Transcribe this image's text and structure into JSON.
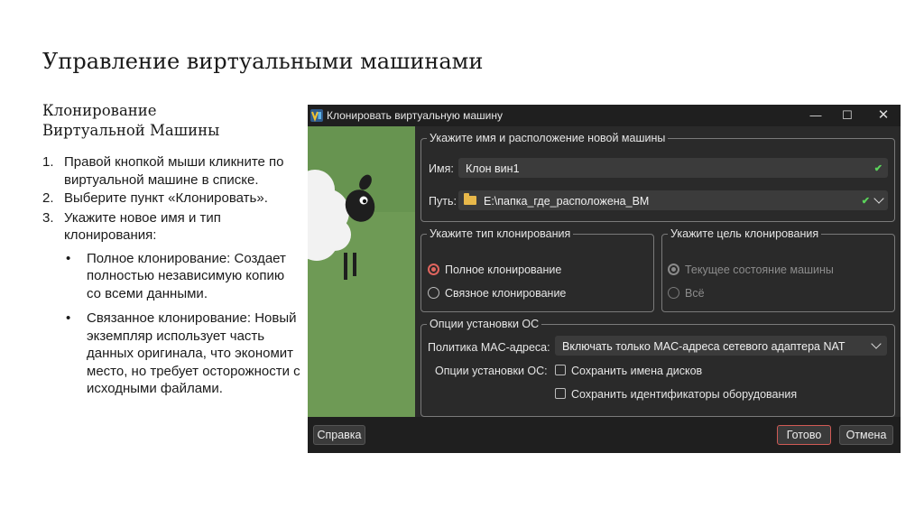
{
  "slide": {
    "title": "Управление виртуальными машинами",
    "subtitle_line1": "Клонирование",
    "subtitle_line2": "Виртуальной Машины",
    "steps": [
      {
        "num": "1.",
        "text": "Правой кнопкой мыши кликните по виртуальной машине в списке."
      },
      {
        "num": "2.",
        "text": "Выберите пункт «Клонировать»."
      },
      {
        "num": "3.",
        "text": "Укажите новое имя и тип клонирования:"
      }
    ],
    "bullets": [
      {
        "mark": "•",
        "text": "Полное клонирование: Создает полностью независимую копию со всеми данными."
      },
      {
        "mark": "•",
        "text": "Связанное клонирование: Новый экземпляр использует часть данных оригинала, что экономит место, но требует осторожности с исходными файлами."
      }
    ]
  },
  "dialog": {
    "title": "Клонировать виртуальную машину",
    "controls": {
      "minimize": "—",
      "maximize": "☐",
      "close": "✕"
    },
    "name_group": {
      "legend": "Укажите имя и расположение новой машины",
      "name_label": "Имя:",
      "name_value": "Клон вин1",
      "path_label": "Путь:",
      "path_value": "E:\\папка_где_расположена_ВМ",
      "valid_mark": "✔"
    },
    "clone_type": {
      "legend": "Укажите тип клонирования",
      "options": [
        {
          "label": "Полное клонирование",
          "selected": true
        },
        {
          "label": "Связное клонирование",
          "selected": false
        }
      ]
    },
    "clone_target": {
      "legend": "Укажите цель клонирования",
      "options": [
        {
          "label": "Текущее состояние машины",
          "selected": true,
          "disabled": true
        },
        {
          "label": "Всё",
          "selected": false,
          "disabled": true
        }
      ]
    },
    "os_options": {
      "legend": "Опции установки ОС",
      "mac_label": "Политика MAC-адреса:",
      "mac_value": "Включать только MAC-адреса сетевого адаптера NAT",
      "options_label": "Опции установки ОС:",
      "checkboxes": [
        {
          "label": "Сохранить имена дисков",
          "checked": false
        },
        {
          "label": "Сохранить идентификаторы оборудования",
          "checked": false
        }
      ]
    },
    "buttons": {
      "help": "Справка",
      "ok": "Готово",
      "cancel": "Отмена"
    },
    "colors": {
      "accent": "#e0655e",
      "valid": "#5bd45b",
      "art_bg": "#6e9a55",
      "panel": "#2a2a2a"
    }
  }
}
